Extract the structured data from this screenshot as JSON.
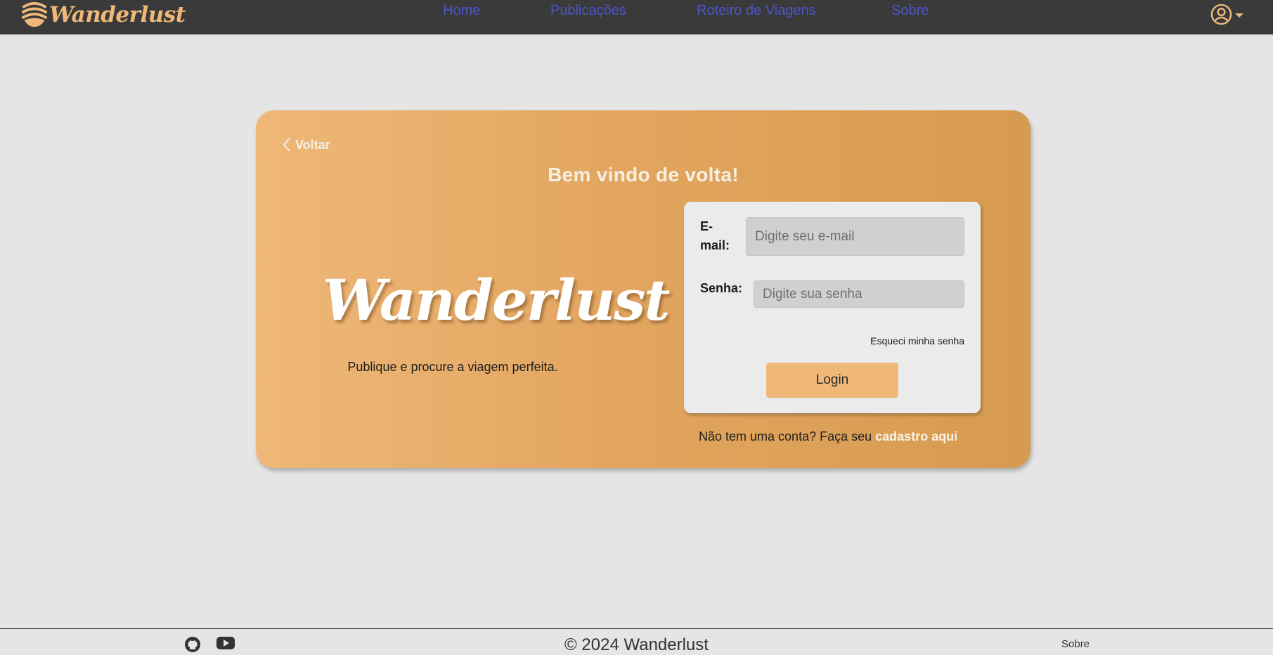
{
  "navbar": {
    "brand": "Wanderlust",
    "links": [
      {
        "label": "Home"
      },
      {
        "label": "Publicações"
      },
      {
        "label": "Roteiro de Viagens"
      },
      {
        "label": "Sobre"
      }
    ],
    "link_color": "#4a56c9",
    "background": "#3a3a3a",
    "user_icon": "user-circle-icon"
  },
  "card": {
    "back_label": "Voltar",
    "title": "Bem vindo de volta!",
    "brand": "Wanderlust",
    "tagline": "Publique e procure a viagem perfeita.",
    "gradient": [
      "#efb878",
      "#d69a50"
    ]
  },
  "form": {
    "email_label": "E-mail:",
    "email_placeholder": "Digite seu e-mail",
    "password_label": "Senha:",
    "password_placeholder": "Digite sua senha",
    "forgot_label": "Esqueci minha senha",
    "login_label": "Login",
    "signup_prefix": "Não tem uma conta? Faça seu",
    "signup_link": "cadastro aqui",
    "accent": "#f0b878"
  },
  "footer": {
    "icons": [
      "github-icon",
      "youtube-icon"
    ],
    "copyright": "© 2024 Wanderlust",
    "link": "Sobre"
  }
}
